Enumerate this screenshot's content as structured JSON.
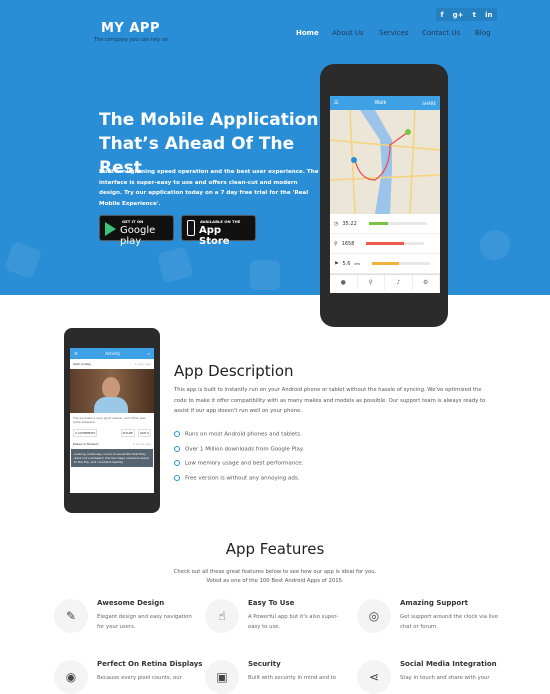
{
  "header": {
    "logo": "MY APP",
    "tagline": "The company you can rely on",
    "social": [
      "f",
      "g+",
      "t",
      "in"
    ],
    "nav": [
      "Home",
      "About Us",
      "Services",
      "Contact Us",
      "Blog"
    ]
  },
  "hero": {
    "title_line1": "The Mobile Application",
    "title_line2": "That’s Ahead Of The Rest",
    "lead": "Built for lightning speed operation and the best user experience. The interface is super-easy to use and offers clean-cut and modern design. Try our application today on a 7 day free trial for the 'Real Mobile Experience'.",
    "google_small": "GET IT ON",
    "google_big": "Google play",
    "apple_small": "AVAILABLE ON THE",
    "apple_big": "App Store"
  },
  "phone": {
    "title": "Walk",
    "share": "SHARE",
    "stats": [
      {
        "icon": "clock",
        "value": "35:22",
        "progress": 0.33,
        "color": "#7cc243"
      },
      {
        "icon": "steps",
        "value": "1658",
        "progress": 0.64,
        "color": "#ec5a4d"
      },
      {
        "icon": "flag",
        "value": "5.6",
        "unit": "km",
        "progress": 0.46,
        "color": "#f2b13d"
      }
    ]
  },
  "phone2": {
    "title": "Activity",
    "user1": "Seth Audley",
    "time1": "1 hour ago",
    "post": "The sounded a very good reason, and other was quite pleasant..",
    "btn_comments": "2 COMMENTS",
    "btn_share": "SHARE",
    "btn_like": "LIKE 6",
    "user2": "Rebecca Stewart",
    "time2": "2 hours ago",
    "post2": "Looking cautiously round, to ascertain that they were not overheard, the two hags cowered nearer to the fire, and chuckled heartily."
  },
  "description": {
    "title": "App Description",
    "text": "This app is built to instantly run on your Android phone or tablet without the hassle of syncing. We've optimized the code to make it offer compatibility with as many makes and models as possible. Our support team is always ready to assist if our app doesn't run well on your phone.",
    "bullets": [
      "Runs on most Android phones and tablets.",
      "Over 1 Million downloads from Google Play.",
      "Low memory usage and best performance.",
      "Free version is without any annoying ads."
    ]
  },
  "features": {
    "title": "App Features",
    "subtitle1": "Check out all these great features below to see how our app is ideal for you.",
    "subtitle2": "Voted as one of the 100 Best Android Apps of 2015.",
    "items": [
      {
        "icon": "magic-wand",
        "title": "Awesome Design",
        "text": "Elegant design and easy navigation for your users."
      },
      {
        "icon": "hand-pointer",
        "title": "Easy To Use",
        "text": "A Powerful app but it's also super-easy to use."
      },
      {
        "icon": "life-ring",
        "title": "Amazing Support",
        "text": "Get support around the clock via live chat or forum."
      },
      {
        "icon": "eye",
        "title": "Perfect On Retina Displays",
        "text": "Because every pixel counts, our"
      },
      {
        "icon": "lock",
        "title": "Security",
        "text": "Built with security in mind and to"
      },
      {
        "icon": "share",
        "title": "Social Media Integration",
        "text": "Stay in touch and share with your"
      }
    ]
  }
}
